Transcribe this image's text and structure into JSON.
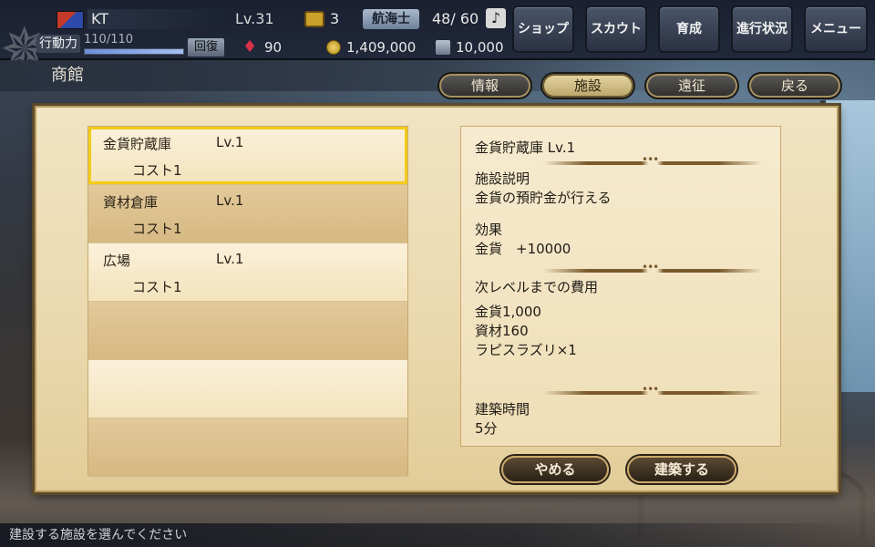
{
  "header": {
    "player_name": "KT",
    "level": "Lv.31",
    "chest_count": "3",
    "rank": "航海士",
    "crew": "48/ 60",
    "music_icon": "music-note-icon",
    "ap_label": "行動力",
    "ap_value": "110/110",
    "ap_fill": 1.0,
    "recover_label": "回復",
    "gems": "90",
    "coins": "1,409,000",
    "materials": "10,000"
  },
  "nav": {
    "shop": "ショップ",
    "scout": "スカウト",
    "train": "育成",
    "progress": "進行状況",
    "menu": "メニュー"
  },
  "page": {
    "title": "商館",
    "tabs": [
      "情報",
      "施設",
      "遠征",
      "戻る"
    ],
    "active_tab": "施設"
  },
  "facilities": [
    {
      "name": "金貨貯蔵庫",
      "level": "Lv.1",
      "cost": "コスト1"
    },
    {
      "name": "資材倉庫",
      "level": "Lv.1",
      "cost": "コスト1"
    },
    {
      "name": "広場",
      "level": "Lv.1",
      "cost": "コスト1"
    }
  ],
  "detail": {
    "title": "金貨貯蔵庫 Lv.1",
    "desc_heading": "施設説明",
    "desc": "金貨の預貯金が行える",
    "effect_heading": "効果",
    "effect": "金貨　+10000",
    "cost_heading": "次レベルまでの費用",
    "costs": [
      "金貨1,000",
      "資材160",
      "ラピスラズリ×1"
    ],
    "time_heading": "建築時間",
    "time": "5分"
  },
  "actions": {
    "cancel": "やめる",
    "build": "建築する"
  },
  "status_message": "建設する施設を選んでください",
  "colors": {
    "selected_border": "#f2cc19",
    "parchment": "#f1e4c3",
    "button_dark": "#2a2116"
  }
}
